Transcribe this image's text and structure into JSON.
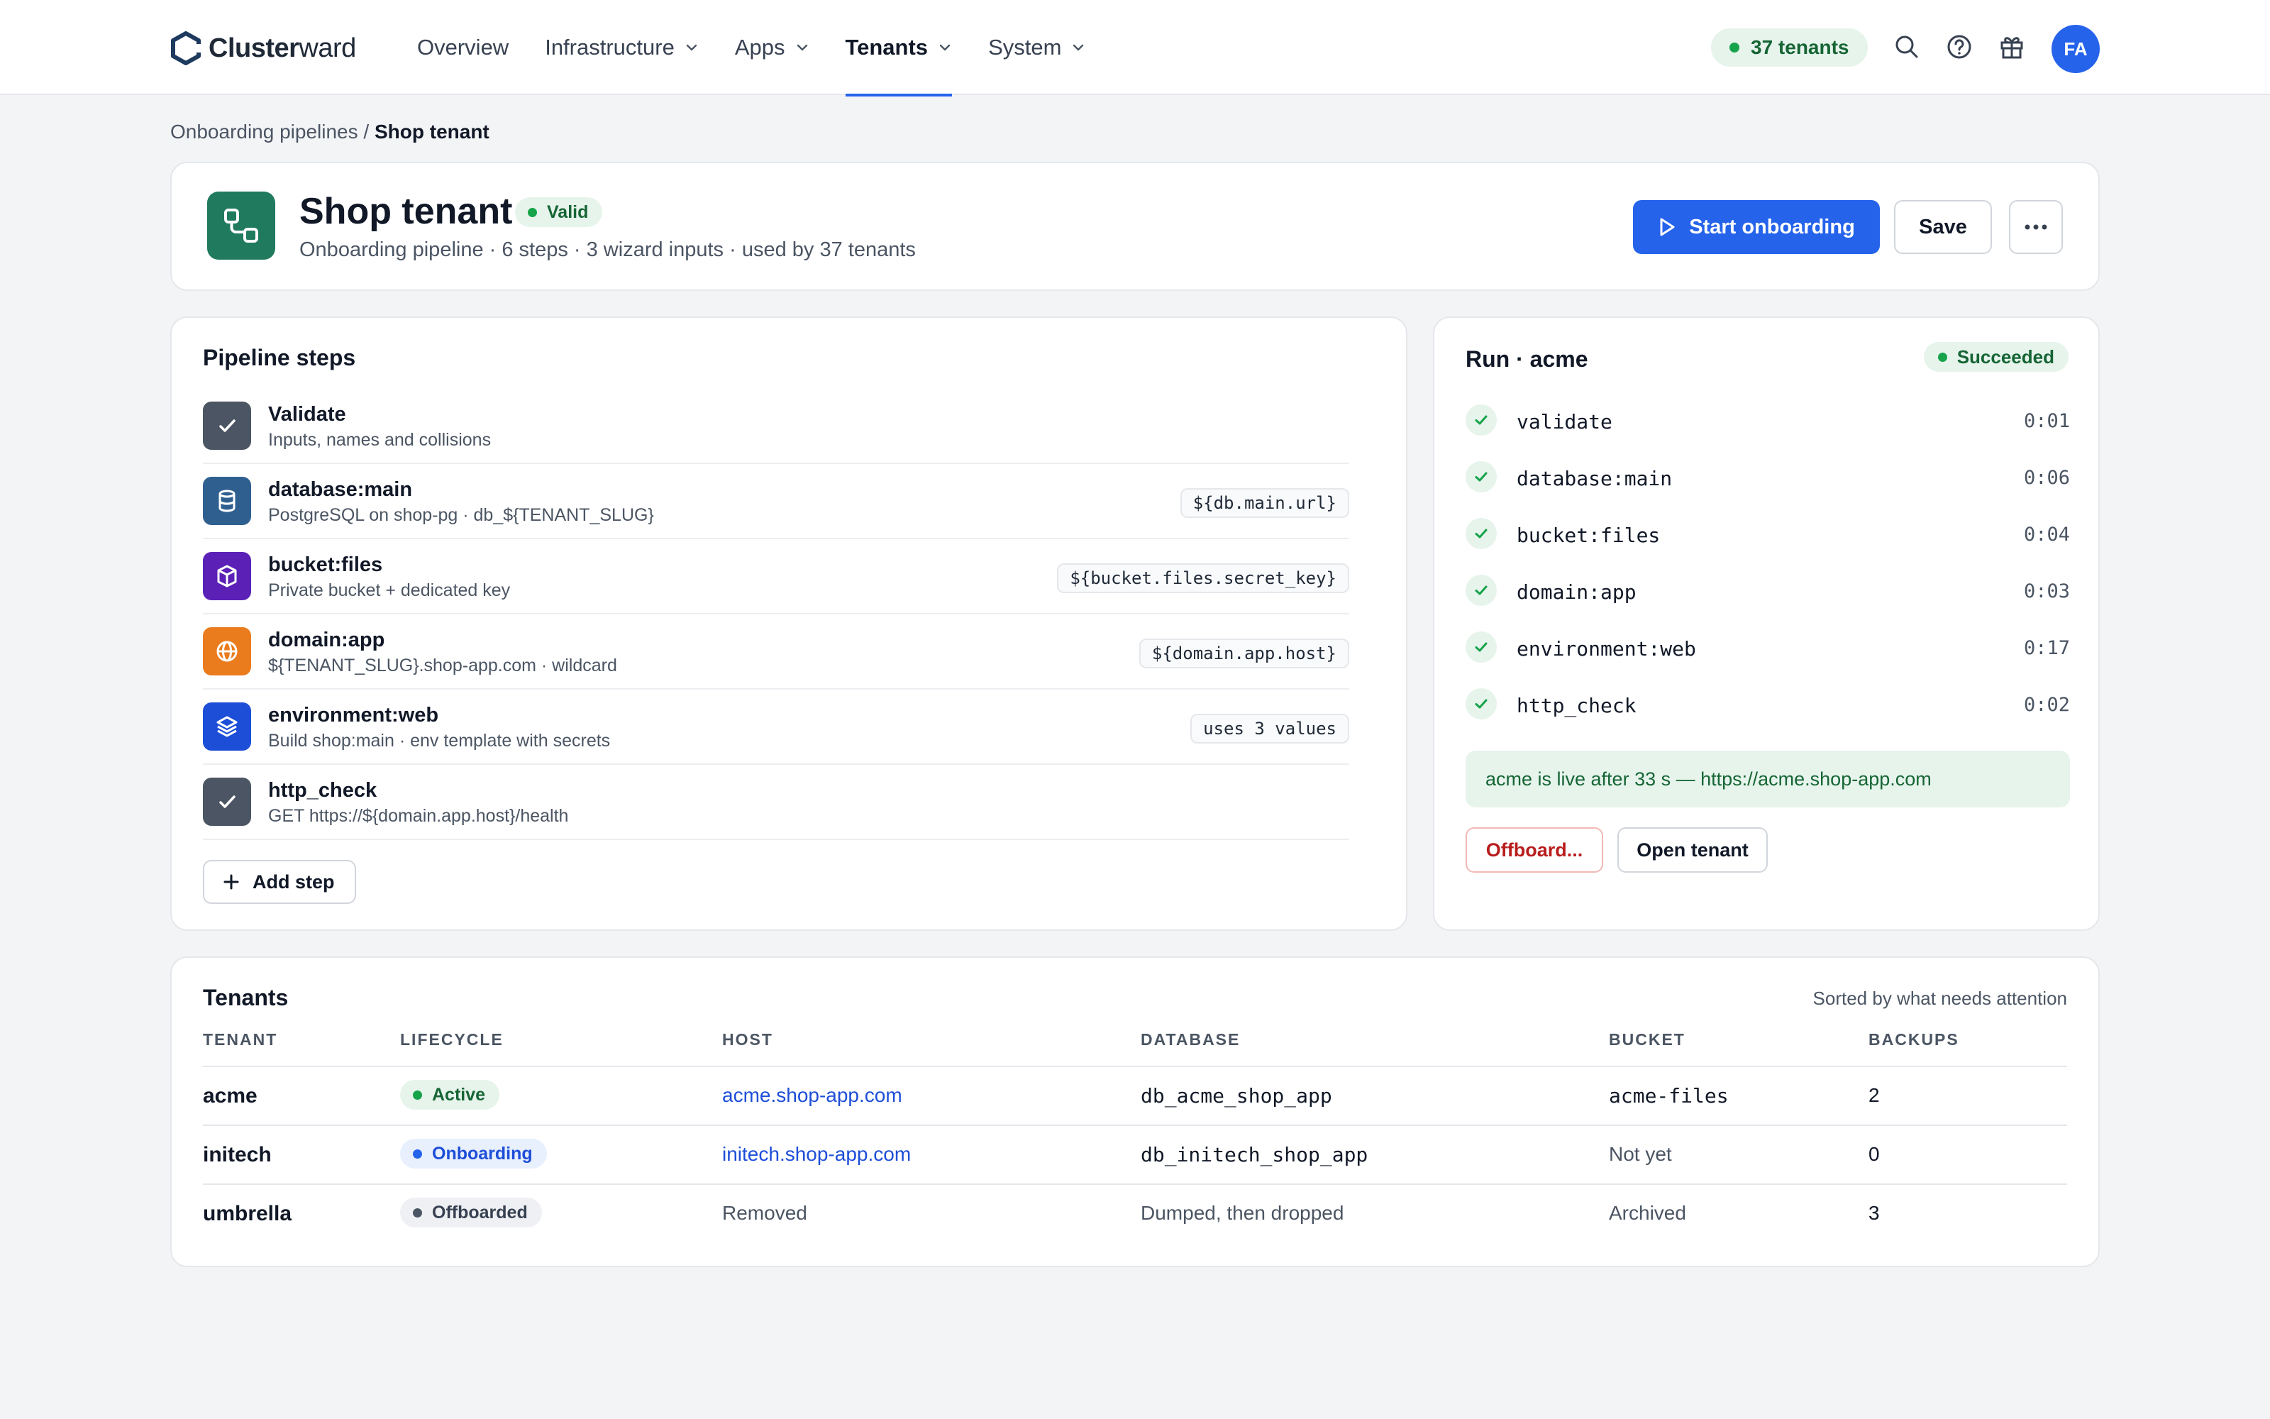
{
  "nav": {
    "logo_bold": "Cluster",
    "logo_light": "ward",
    "items": [
      {
        "label": "Overview",
        "dropdown": false,
        "active": false
      },
      {
        "label": "Infrastructure",
        "dropdown": true,
        "active": false
      },
      {
        "label": "Apps",
        "dropdown": true,
        "active": false
      },
      {
        "label": "Tenants",
        "dropdown": true,
        "active": true
      },
      {
        "label": "System",
        "dropdown": true,
        "active": false
      }
    ],
    "tenant_count": "37 tenants",
    "icons": [
      "search-icon",
      "help-icon",
      "gift-icon"
    ],
    "avatar_initials": "FA"
  },
  "breadcrumb": {
    "parent": "Onboarding pipelines",
    "separator": " / ",
    "current": "Shop tenant"
  },
  "header": {
    "title": "Shop tenant",
    "status": "Valid",
    "subtitle": "Onboarding pipeline · 6 steps · 3 wizard inputs · used by 37 tenants",
    "primary_button": "Start onboarding",
    "save_button": "Save",
    "more_button": "···"
  },
  "pipeline": {
    "title": "Pipeline steps",
    "steps": [
      {
        "name": "Validate",
        "desc": "Inputs, names and collisions",
        "chip": "",
        "icon": "check-icon",
        "color": "#4b5563"
      },
      {
        "name": "database:main",
        "desc": "PostgreSQL on shop-pg · db_${TENANT_SLUG}",
        "chip": "${db.main.url}",
        "icon": "database-icon",
        "color": "#2f5f8f"
      },
      {
        "name": "bucket:files",
        "desc": "Private bucket + dedicated key",
        "chip": "${bucket.files.secret_key}",
        "icon": "cube-icon",
        "color": "#5b21b6"
      },
      {
        "name": "domain:app",
        "desc": "${TENANT_SLUG}.shop-app.com · wildcard",
        "chip": "${domain.app.host}",
        "icon": "globe-icon",
        "color": "#ea7c1e"
      },
      {
        "name": "environment:web",
        "desc": "Build shop:main · env template with secrets",
        "chip": "uses 3 values",
        "icon": "layers-icon",
        "color": "#1d4ed8"
      },
      {
        "name": "http_check",
        "desc": "GET https://${domain.app.host}/health",
        "chip": "",
        "icon": "check-icon",
        "color": "#4b5563"
      }
    ],
    "add_step": "Add step"
  },
  "run": {
    "title": "Run · acme",
    "status": "Succeeded",
    "steps": [
      {
        "name": "validate",
        "time": "0:01"
      },
      {
        "name": "database:main",
        "time": "0:06"
      },
      {
        "name": "bucket:files",
        "time": "0:04"
      },
      {
        "name": "domain:app",
        "time": "0:03"
      },
      {
        "name": "environment:web",
        "time": "0:17"
      },
      {
        "name": "http_check",
        "time": "0:02"
      }
    ],
    "live_message": "acme is live after 33 s — https://acme.shop-app.com",
    "offboard_button": "Offboard...",
    "open_button": "Open tenant"
  },
  "tenants": {
    "title": "Tenants",
    "note": "Sorted by what needs attention",
    "columns": [
      "TENANT",
      "LIFECYCLE",
      "HOST",
      "DATABASE",
      "BUCKET",
      "BACKUPS"
    ],
    "rows": [
      {
        "tenant": "acme",
        "lifecycle": "Active",
        "lc_bg": "#e6f4ec",
        "lc_fg": "#166534",
        "lc_dot": "#16a34a",
        "host": "acme.shop-app.com",
        "host_link": true,
        "database": "db_acme_shop_app",
        "db_mono": true,
        "bucket": "acme-files",
        "bucket_mono": true,
        "backups": "2"
      },
      {
        "tenant": "initech",
        "lifecycle": "Onboarding",
        "lc_bg": "#e8effd",
        "lc_fg": "#1d4ed8",
        "lc_dot": "#2563eb",
        "host": "initech.shop-app.com",
        "host_link": true,
        "database": "db_initech_shop_app",
        "db_mono": true,
        "bucket": "Not yet",
        "bucket_mono": false,
        "backups": "0"
      },
      {
        "tenant": "umbrella",
        "lifecycle": "Offboarded",
        "lc_bg": "#eef0f3",
        "lc_fg": "#374151",
        "lc_dot": "#4b5563",
        "host": "Removed",
        "host_link": false,
        "database": "Dumped, then dropped",
        "db_mono": false,
        "bucket": "Archived",
        "bucket_mono": false,
        "backups": "3"
      }
    ]
  },
  "colors": {
    "accent": "#2563eb",
    "success": "#16a34a",
    "danger": "#b91c1c",
    "brand_tile": "#1f7a5e"
  }
}
